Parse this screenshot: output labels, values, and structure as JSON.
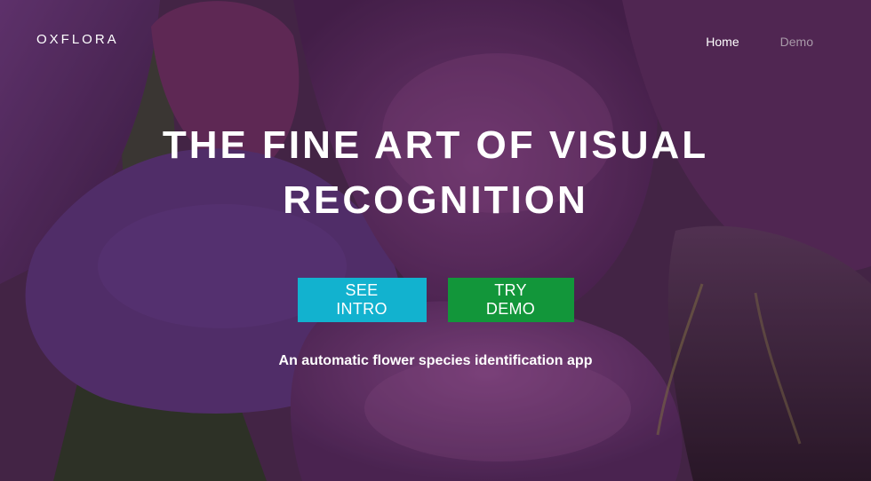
{
  "brand": {
    "name": "OXFLORA"
  },
  "nav": {
    "items": [
      {
        "label": "Home"
      },
      {
        "label": "Demo"
      }
    ]
  },
  "hero": {
    "headline_line1": "THE FINE ART OF VISUAL",
    "headline_line2": "RECOGNITION",
    "tagline": "An automatic flower species identification app",
    "background_image": "purple-flower-photo"
  },
  "buttons": {
    "intro_label": "SEE INTRO",
    "demo_label": "TRY DEMO"
  },
  "colors": {
    "intro_button": "#12b2cf",
    "demo_button": "#12963a",
    "text": "#ffffff",
    "nav_inactive": "#a99aa9"
  }
}
